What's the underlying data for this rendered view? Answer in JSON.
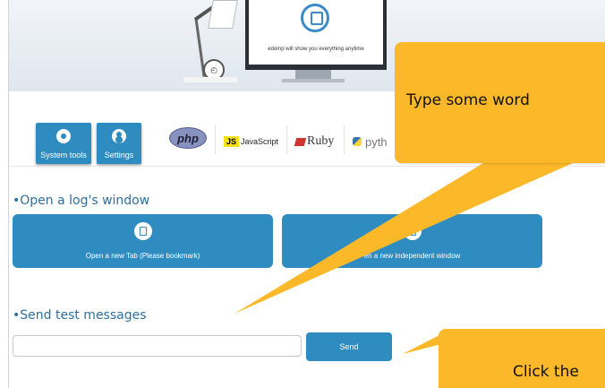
{
  "banner": {
    "tagline": "edomp will show you everything anytime",
    "clock_glyph": "◴"
  },
  "toolbar": {
    "system_tools_label": "System tools",
    "settings_label": "Settings"
  },
  "languages": {
    "php": "php",
    "js_badge": "JS",
    "js_text": "JavaScript",
    "ruby": "Ruby",
    "python": "pyth"
  },
  "log_section": {
    "title": "•Open a log's window",
    "new_tab_label": "Open a new Tab (Please bookmark)",
    "new_window_label": "en a new independent window"
  },
  "send_section": {
    "title": "•Send test messages",
    "input_value": "",
    "send_label": "Send"
  },
  "tooltips": {
    "type_hint": "Type some word",
    "click_hint": "Click the"
  },
  "colors": {
    "accent_blue": "#2f8cc0",
    "tooltip_yellow": "#fbb829",
    "section_title": "#2f6f9c"
  }
}
